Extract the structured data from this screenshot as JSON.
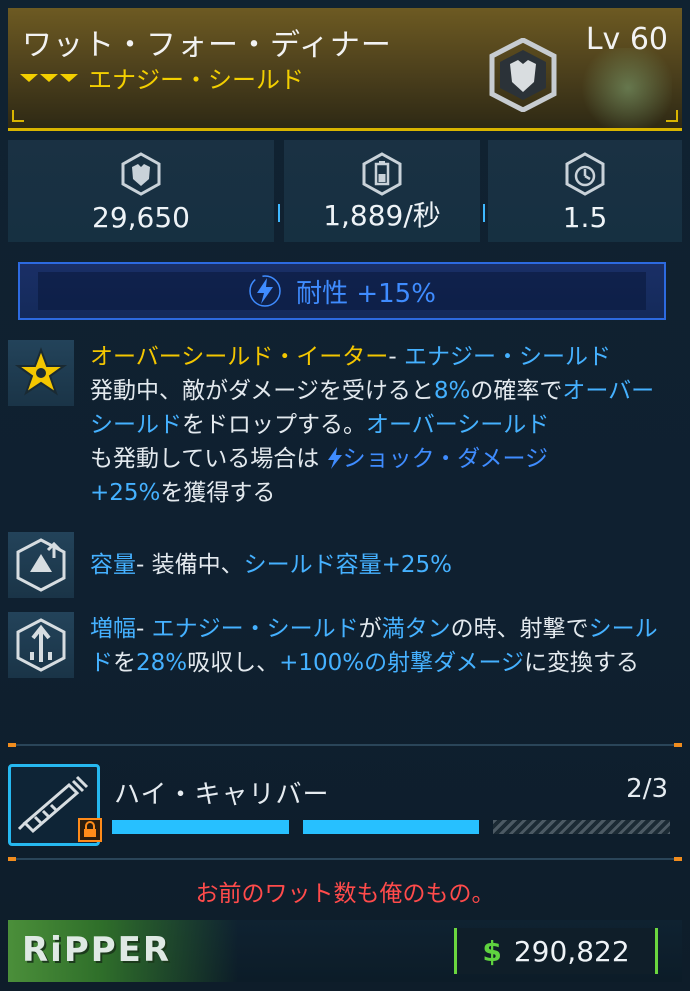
{
  "header": {
    "item_name": "ワット・フォー・ディナー",
    "level": "Lv 60",
    "item_type": "エナジー・シールド",
    "rarity_icon": "chevron-rarity-icon",
    "type_icon": "shield-emblem-icon",
    "accent_color": "#f3cf00"
  },
  "stats": [
    {
      "icon": "shield-capacity-icon",
      "value": "29,650"
    },
    {
      "icon": "battery-recharge-icon",
      "value": "1,889/秒"
    },
    {
      "icon": "recharge-delay-icon",
      "value": "1.5"
    }
  ],
  "element": {
    "icon": "shock-bolt-icon",
    "text": "耐性 +15%",
    "color": "#3f8cff"
  },
  "perks": [
    {
      "icon": "star-perk-icon",
      "title": "オーバーシールド・イーター",
      "sep": "-",
      "t1": "エナジー・シールド",
      "t2": "発動中、敵がダメージを受けると",
      "t3": "8%",
      "t4": "の確率で",
      "t5": "オーバーシールド",
      "t6": "をドロップする。",
      "t7": "オーバーシールド",
      "t8": "も発動している場合は",
      "t9": "ショック・ダメージ",
      "t10": "+25%",
      "t11": "を獲得する"
    },
    {
      "icon": "capacity-up-icon",
      "title": "容量",
      "t1": "- 装備中、",
      "t2": "シールド容量+25%"
    },
    {
      "icon": "amplify-icon",
      "title": "増幅",
      "t1": "- ",
      "t2": "エナジー・シールド",
      "t3": "が",
      "t4": "満タン",
      "t5": "の時、射撃で",
      "t6": "シールド",
      "t7": "を",
      "t8": "28%",
      "t9": "吸収し、",
      "t10": "+100%の射撃ダメージ",
      "t11": "に変換する"
    }
  ],
  "part": {
    "icon": "syringe-part-icon",
    "lock_icon": "lock-icon",
    "name": "ハイ・キャリバー",
    "count": "2/3",
    "filled": 2,
    "total": 3
  },
  "flavor": "お前のワット数も俺のもの。",
  "footer": {
    "manufacturer": "RiPPER",
    "currency_icon": "dollar-icon",
    "price": "290,822"
  }
}
